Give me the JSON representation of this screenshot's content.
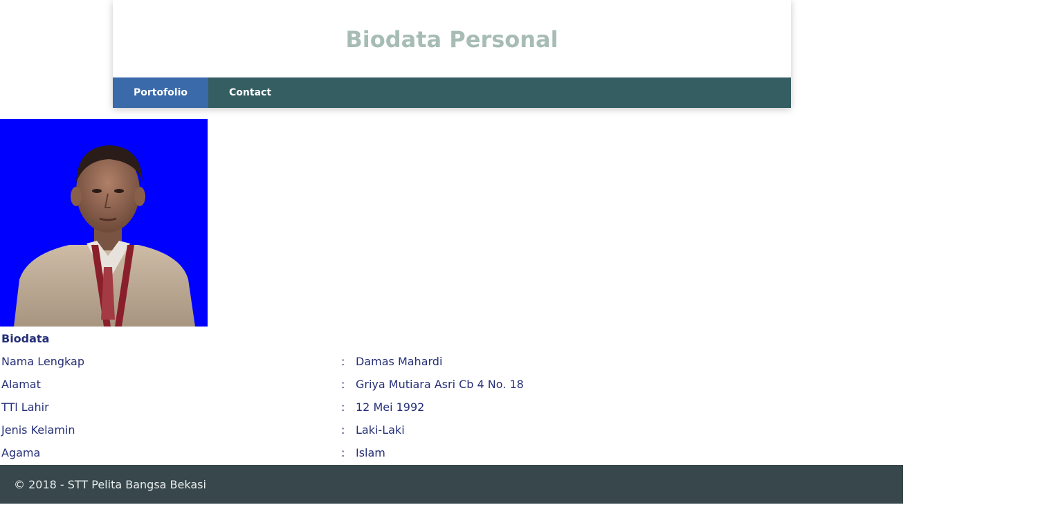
{
  "header": {
    "title": "Biodata Personal"
  },
  "nav": {
    "items": [
      {
        "label": "Portofolio",
        "active": true
      },
      {
        "label": "Contact",
        "active": false
      }
    ]
  },
  "colors": {
    "title": "#a6bcb4",
    "navbar": "#355e63",
    "nav_active": "#3a6aa9",
    "text": "#252f78",
    "photo_background": "#0000ff",
    "footer": "#37474b"
  },
  "biodata": {
    "heading": "Biodata",
    "rows": [
      {
        "label": "Nama Lengkap",
        "colon": ":",
        "value": "Damas Mahardi"
      },
      {
        "label": "Alamat",
        "colon": ":",
        "value": "Griya Mutiara Asri Cb 4 No. 18"
      },
      {
        "label": "TTl Lahir",
        "colon": ":",
        "value": "12 Mei 1992"
      },
      {
        "label": "Jenis Kelamin",
        "colon": ":",
        "value": "Laki-Laki"
      },
      {
        "label": "Agama",
        "colon": ":",
        "value": "Islam"
      }
    ]
  },
  "footer": {
    "text": "© 2018 - STT Pelita Bangsa Bekasi"
  }
}
